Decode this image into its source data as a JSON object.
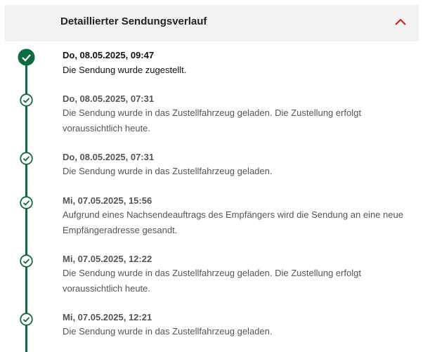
{
  "header": {
    "title": "Detaillierter Sendungsverlauf",
    "toggle_icon": "chevron-up-icon",
    "accent_color": "#cc1a1a"
  },
  "timeline": {
    "line_color": "#0e6b3f",
    "marker_icon": "check-circle-icon",
    "events": [
      {
        "date": "Do, 08.05.2025, 09:47",
        "text": "Die Sendung wurde zugestellt."
      },
      {
        "date": "Do, 08.05.2025, 07:31",
        "text": "Die Sendung wurde in das Zustellfahrzeug geladen. Die Zustellung erfolgt voraussichtlich heute."
      },
      {
        "date": "Do, 08.05.2025, 07:31",
        "text": "Die Sendung wurde in das Zustellfahrzeug geladen."
      },
      {
        "date": "Mi, 07.05.2025, 15:56",
        "text": "Aufgrund eines Nachsendeauftrags des Empfängers wird die Sendung an eine neue Empfängeradresse gesandt."
      },
      {
        "date": "Mi, 07.05.2025, 12:22",
        "text": "Die Sendung wurde in das Zustellfahrzeug geladen. Die Zustellung erfolgt voraussichtlich heute."
      },
      {
        "date": "Mi, 07.05.2025, 12:21",
        "text": "Die Sendung wurde in das Zustellfahrzeug geladen."
      }
    ]
  }
}
